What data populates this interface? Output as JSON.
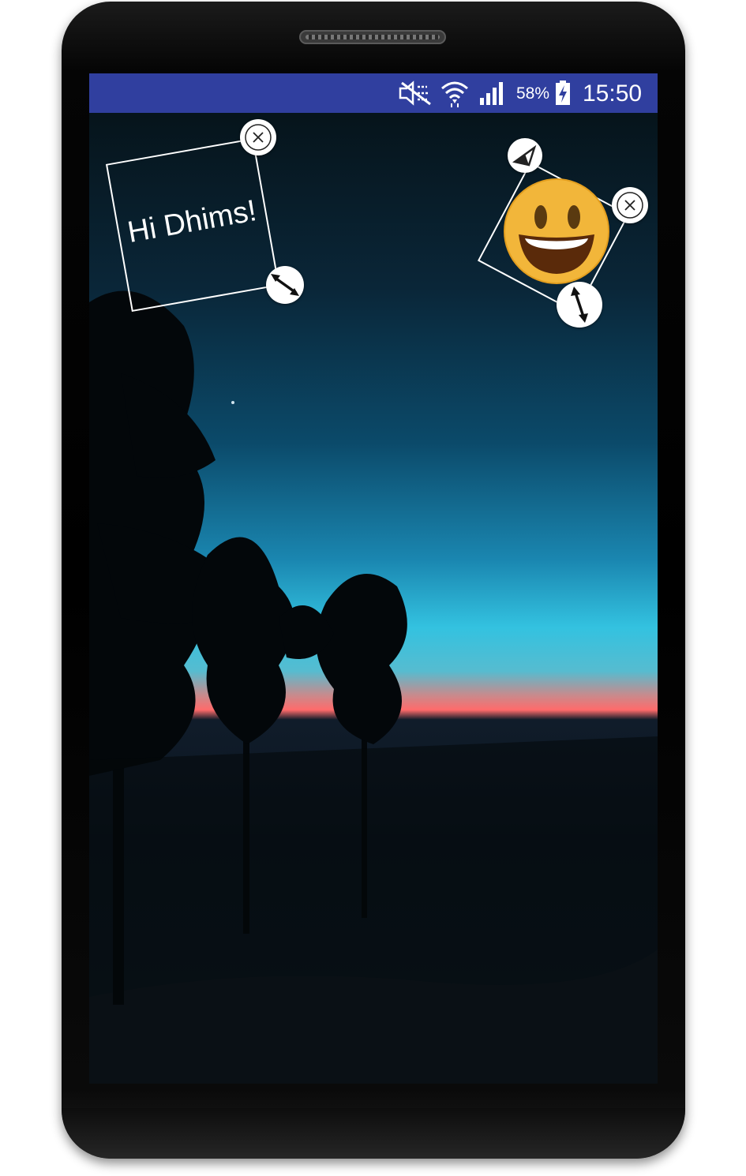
{
  "status_bar": {
    "battery_percent": "58%",
    "time": "15:50",
    "icons": [
      "mute-icon",
      "wifi-icon",
      "signal-icon",
      "battery-charging-icon"
    ]
  },
  "stickers": {
    "text_sticker": {
      "text": "Hi Dhims!"
    },
    "emoji_sticker": {
      "icon": "smiling-face-emoji"
    }
  },
  "colors": {
    "status_bar": "#303f9f",
    "sticker_border": "#ffffff"
  }
}
